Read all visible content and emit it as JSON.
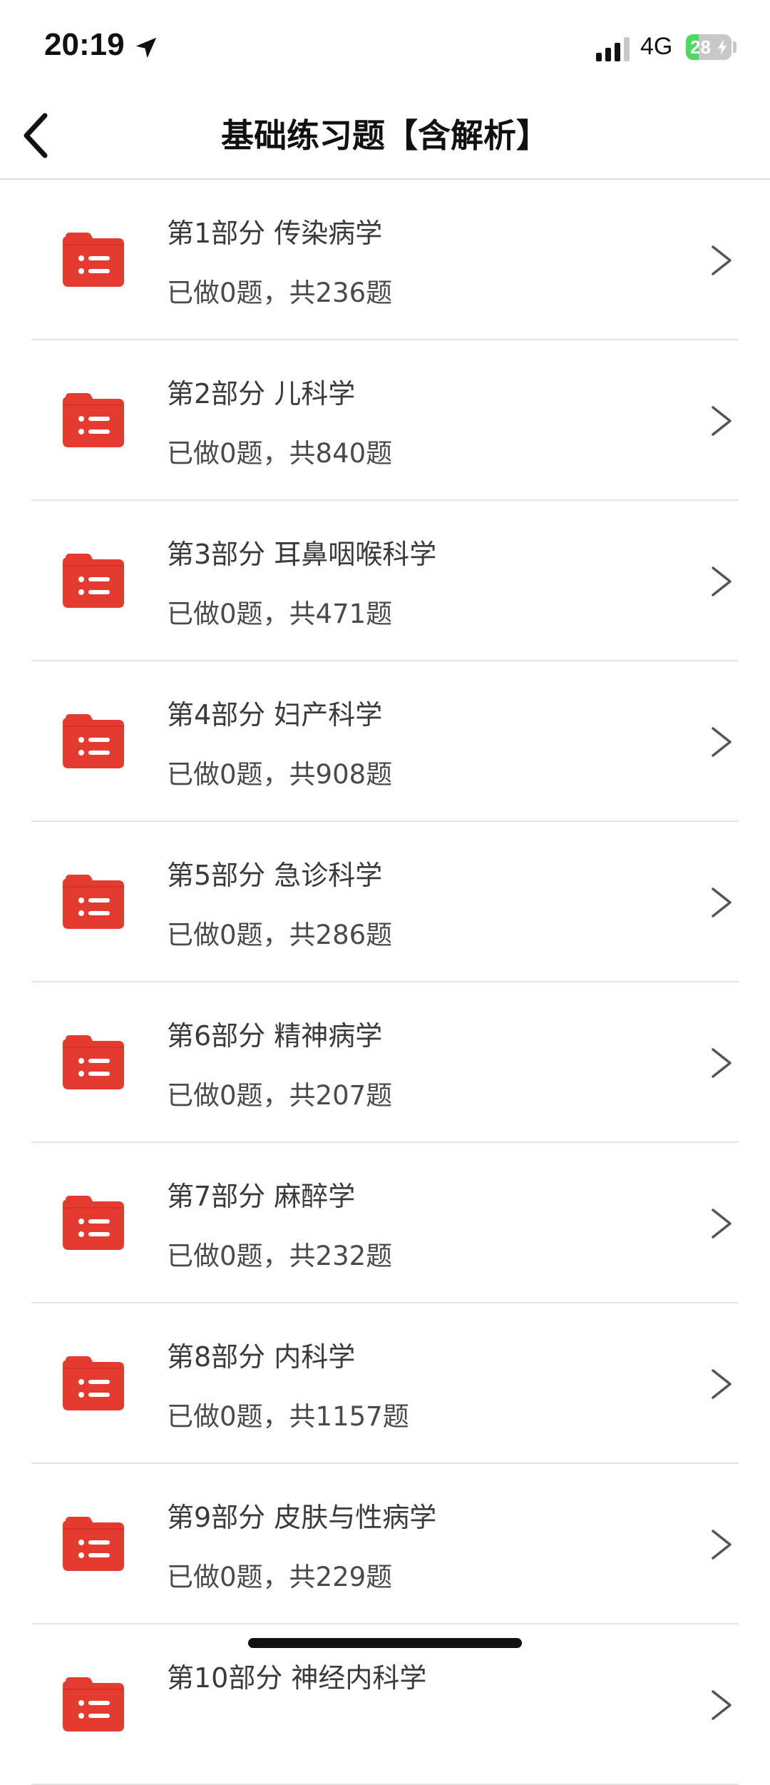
{
  "status_bar": {
    "time": "20:19",
    "network": "4G",
    "battery": "28",
    "battery_level": 0.28,
    "icons": [
      "location-arrow-icon",
      "signal-bars-icon",
      "battery-charging-icon"
    ]
  },
  "nav": {
    "title": "基础练习题【含解析】",
    "back_icon": "chevron-left-icon"
  },
  "colors": {
    "accent": "#e53a2f",
    "text": "#3a3a3a",
    "divider": "#e4e4e4",
    "battery_green": "#4cd964"
  },
  "items": [
    {
      "title": "第1部分 传染病学",
      "subtitle": "已做0题，共236题"
    },
    {
      "title": "第2部分 儿科学",
      "subtitle": "已做0题，共840题"
    },
    {
      "title": "第3部分 耳鼻咽喉科学",
      "subtitle": "已做0题，共471题"
    },
    {
      "title": "第4部分 妇产科学",
      "subtitle": "已做0题，共908题"
    },
    {
      "title": "第5部分 急诊科学",
      "subtitle": "已做0题，共286题"
    },
    {
      "title": "第6部分 精神病学",
      "subtitle": "已做0题，共207题"
    },
    {
      "title": "第7部分 麻醉学",
      "subtitle": "已做0题，共232题"
    },
    {
      "title": "第8部分 内科学",
      "subtitle": "已做0题，共1157题"
    },
    {
      "title": "第9部分 皮肤与性病学",
      "subtitle": "已做0题，共229题"
    },
    {
      "title": "第10部分 神经内科学",
      "subtitle": ""
    }
  ]
}
